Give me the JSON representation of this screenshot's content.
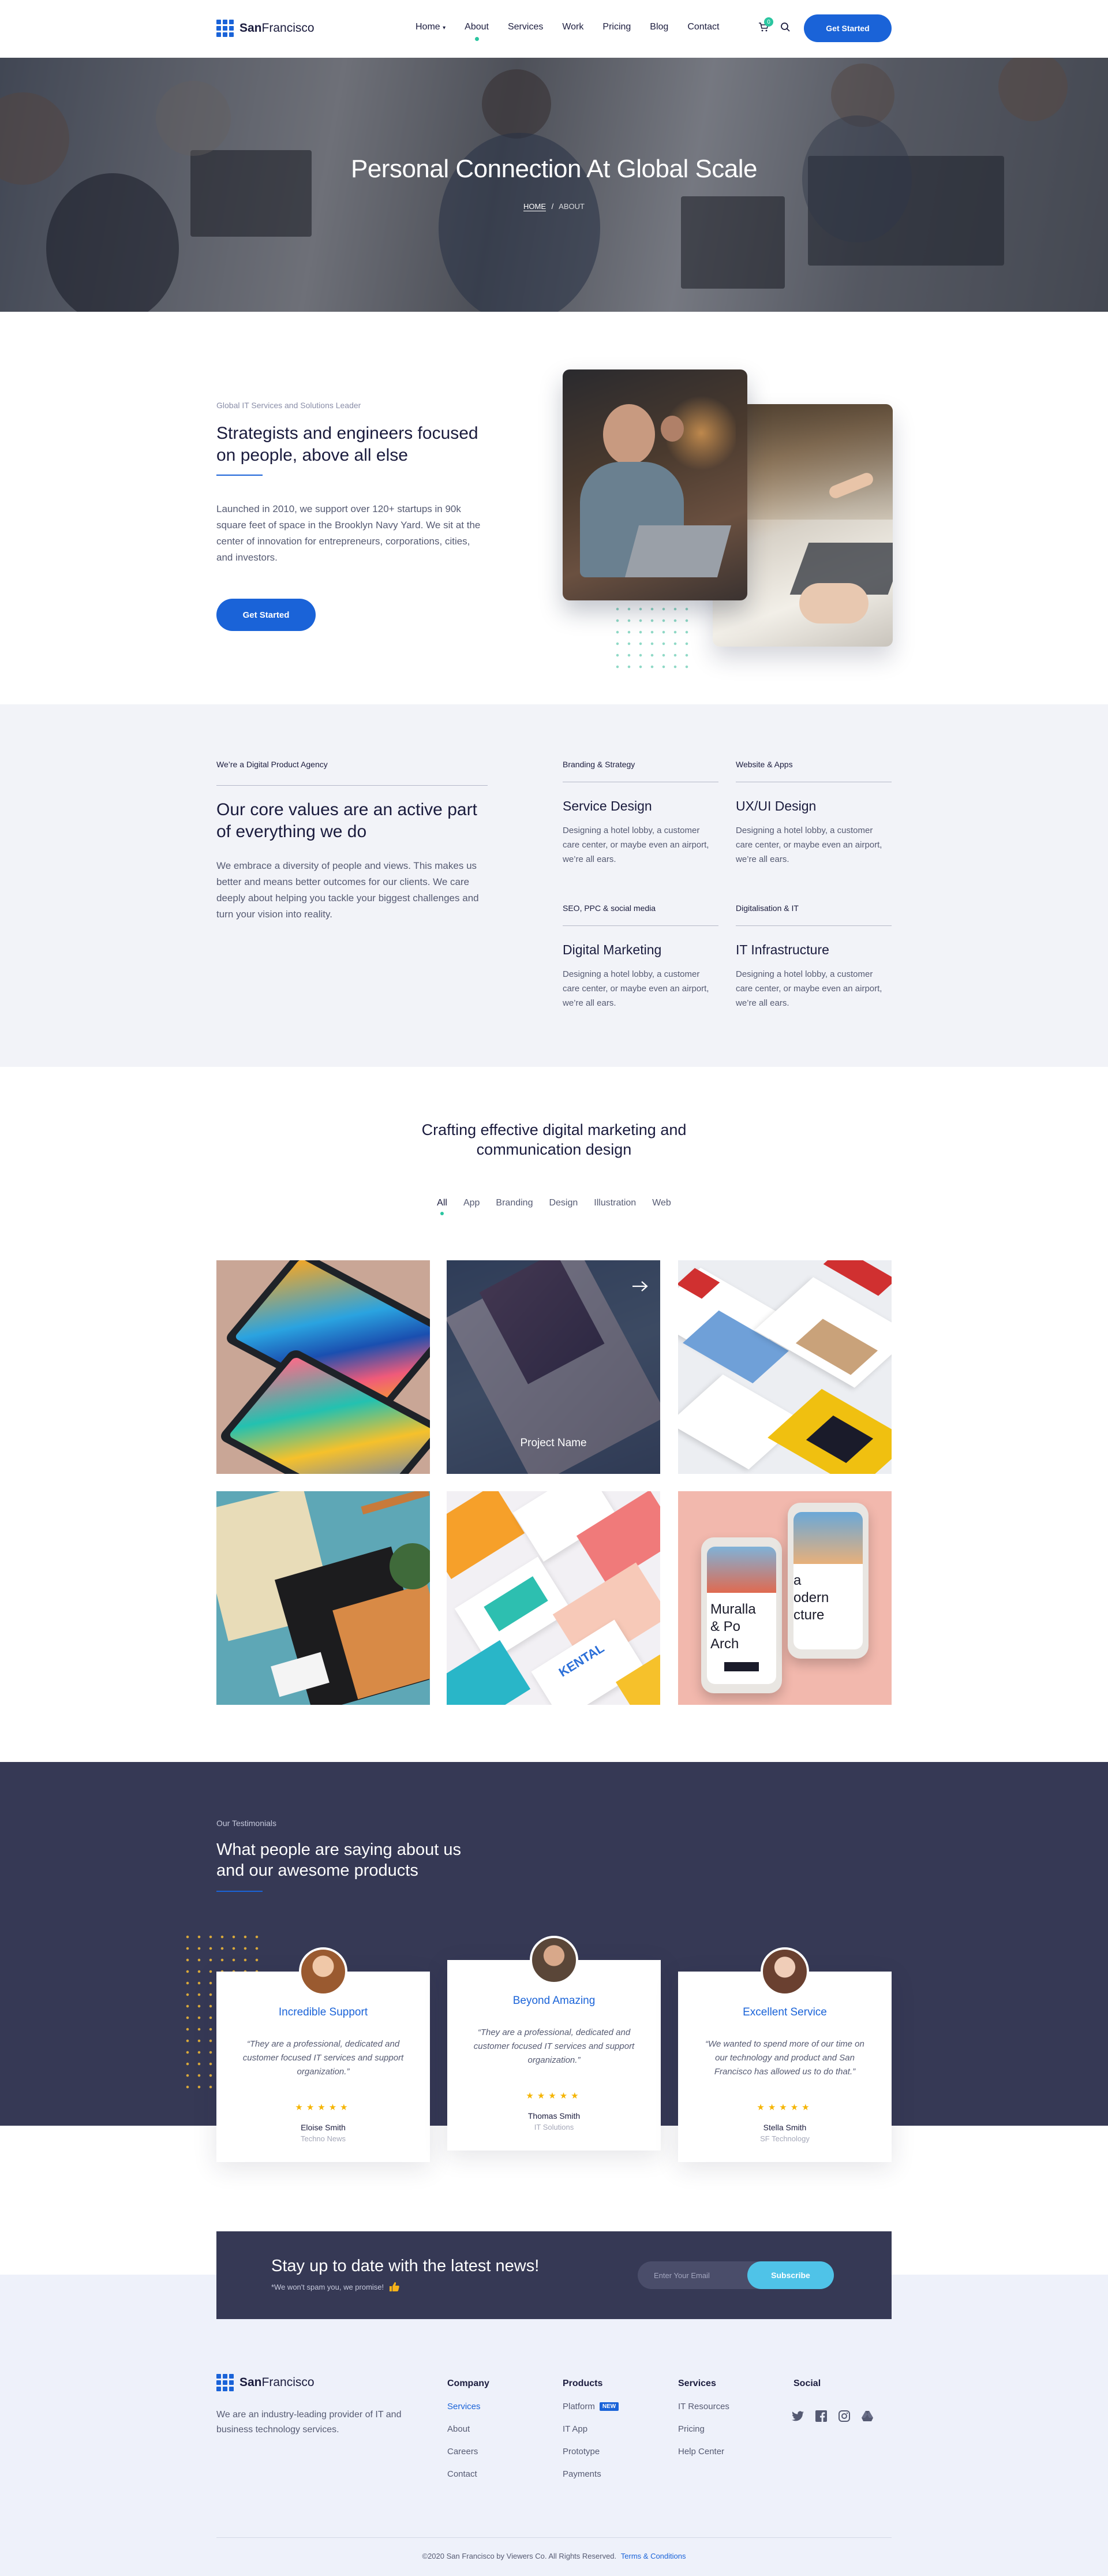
{
  "header": {
    "logo_bold": "San",
    "logo_light": "Francisco",
    "nav": [
      "Home",
      "About",
      "Services",
      "Work",
      "Pricing",
      "Blog",
      "Contact"
    ],
    "cart_count": "0",
    "cta": "Get Started"
  },
  "hero": {
    "title": "Personal Connection At Global Scale",
    "crumb_home": "HOME",
    "crumb_sep": "/",
    "crumb_current": "ABOUT"
  },
  "intro": {
    "kicker": "Global IT Services and Solutions Leader",
    "title": "Strategists and engineers focused on people, above all else",
    "body": "Launched in 2010, we support over 120+ startups in 90k square feet of space in the Brooklyn Navy Yard. We sit at the center of innovation for entrepreneurs, corporations, cities, and investors.",
    "cta": "Get Started"
  },
  "values": {
    "kicker": "We’re a Digital Product Agency",
    "title": "Our core values are an active part of everything we do",
    "body": "We embrace a diversity of people and views. This makes us better and means better outcomes for our clients. We care deeply about helping you tackle your biggest challenges and turn your vision into reality.",
    "services": [
      {
        "cat": "Branding & Strategy",
        "title": "Service Design",
        "desc": "Designing a hotel lobby, a customer care center, or maybe even an airport, we’re all ears."
      },
      {
        "cat": "Website & Apps",
        "title": "UX/UI Design",
        "desc": "Designing a hotel lobby, a customer care center, or maybe even an airport, we’re all ears."
      },
      {
        "cat": "SEO, PPC & social media",
        "title": "Digital Marketing",
        "desc": "Designing a hotel lobby, a customer care center, or maybe even an airport, we’re all ears."
      },
      {
        "cat": "Digitalisation & IT",
        "title": "IT Infrastructure",
        "desc": "Designing a hotel lobby, a customer care center, or maybe even an airport, we’re all ears."
      }
    ]
  },
  "portfolio": {
    "title": "Crafting effective digital marketing and communication design",
    "filters": [
      "All",
      "App",
      "Branding",
      "Design",
      "Illustration",
      "Web"
    ],
    "project_name": "Project Name",
    "phone_text_a": "Muralla",
    "phone_text_b": "& Po",
    "phone_text_c": "Arch",
    "phone_text_d": "a",
    "phone_text_e": "odern",
    "phone_text_f": "cture",
    "kental": "KENTAL"
  },
  "testimonials": {
    "kicker": "Our Testimonials",
    "title": "What people are saying about us and our awesome products",
    "items": [
      {
        "title": "Incredible Support",
        "quote": "“They are a professional, dedicated and customer focused IT services and support organization.”",
        "stars": "★★★★★",
        "name": "Eloise Smith",
        "company": "Techno News"
      },
      {
        "title": "Beyond Amazing",
        "quote": "“They are a professional, dedicated and customer focused IT services and support organization.”",
        "stars": "★★★★★",
        "name": "Thomas Smith",
        "company": "IT Solutions"
      },
      {
        "title": "Excellent Service",
        "quote": "“We wanted to spend more of our time on our technology and product and San Francisco has allowed us to do that.”",
        "stars": "★★★★★",
        "name": "Stella Smith",
        "company": "SF Technology"
      }
    ]
  },
  "newsletter": {
    "title": "Stay up to date with the latest news!",
    "note": "*We won't spam you, we promise!",
    "placeholder": "Enter Your Email",
    "button": "Subscribe"
  },
  "footer": {
    "logo_bold": "San",
    "logo_light": "Francisco",
    "about": "We are an industry-leading provider of IT and business technology services.",
    "columns": [
      {
        "heading": "Company",
        "links": [
          "Services",
          "About",
          "Careers",
          "Contact"
        ]
      },
      {
        "heading": "Products",
        "links": [
          "Platform",
          "IT App",
          "Prototype",
          "Payments"
        ],
        "badge": "NEW"
      },
      {
        "heading": "Services",
        "links": [
          "IT Resources",
          "Pricing",
          "Help Center"
        ]
      },
      {
        "heading": "Social",
        "links": []
      }
    ],
    "copyright": "©2020 San Francisco by Viewers Co. All Rights Reserved.",
    "terms": "Terms & Conditions"
  },
  "colors": {
    "accent": "#1a63d8",
    "green": "#2bc5a0",
    "navy": "#363955",
    "cyan": "#4fc3e8"
  },
  "icons": [
    "chevron-down-icon",
    "cart-icon",
    "search-icon",
    "arrow-right-icon",
    "twitter-icon",
    "facebook-icon",
    "instagram-icon",
    "google-drive-icon",
    "thumbs-up-icon"
  ]
}
